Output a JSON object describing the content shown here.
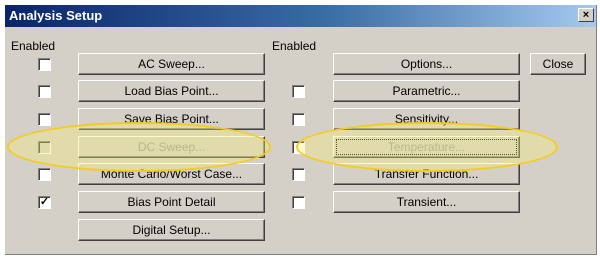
{
  "window": {
    "title": "Analysis Setup",
    "close_glyph": "×"
  },
  "left": {
    "header": "Enabled",
    "rows": [
      {
        "label": "AC Sweep...",
        "checked": false,
        "check_disabled": false,
        "button_disabled": false
      },
      {
        "label": "Load Bias Point...",
        "checked": false,
        "check_disabled": false,
        "button_disabled": false
      },
      {
        "label": "Save Bias Point...",
        "checked": false,
        "check_disabled": false,
        "button_disabled": false
      },
      {
        "label": "DC Sweep...",
        "checked": false,
        "check_disabled": true,
        "button_disabled": true
      },
      {
        "label": "Monte Carlo/Worst Case...",
        "checked": false,
        "check_disabled": false,
        "button_disabled": false
      },
      {
        "label": "Bias Point Detail",
        "checked": true,
        "check_disabled": false,
        "button_disabled": false
      }
    ],
    "digital_setup": "Digital Setup..."
  },
  "right": {
    "header": "Enabled",
    "options_label": "Options...",
    "rows": [
      {
        "label": "Parametric...",
        "checked": false,
        "check_disabled": false,
        "button_disabled": false
      },
      {
        "label": "Sensitivity...",
        "checked": false,
        "check_disabled": false,
        "button_disabled": false
      },
      {
        "label": "Temperature...",
        "checked": false,
        "check_disabled": false,
        "button_disabled": true,
        "focused": true
      },
      {
        "label": "Transfer Function...",
        "checked": false,
        "check_disabled": false,
        "button_disabled": false
      },
      {
        "label": "Transient...",
        "checked": false,
        "check_disabled": false,
        "button_disabled": false
      }
    ]
  },
  "close_label": "Close",
  "check_glyph": "✓",
  "colors": {
    "highlight": "#f5cc1b",
    "title_bar": "#0a246a",
    "face": "#d4d0c8"
  }
}
